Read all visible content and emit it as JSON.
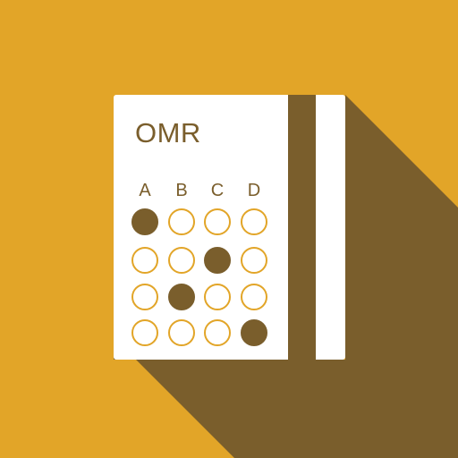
{
  "sheet": {
    "title": "OMR",
    "columns": [
      "A",
      "B",
      "C",
      "D"
    ],
    "answers": [
      [
        true,
        false,
        false,
        false
      ],
      [
        false,
        false,
        true,
        false
      ],
      [
        false,
        true,
        false,
        false
      ],
      [
        false,
        false,
        false,
        true
      ]
    ]
  },
  "colors": {
    "background": "#E2A528",
    "shadow": "#7A5E2C",
    "card": "#FFFFFF",
    "accent": "#7A5E2C",
    "bubble_outline": "#E2A528"
  },
  "icon": "omr-answer-sheet-icon"
}
